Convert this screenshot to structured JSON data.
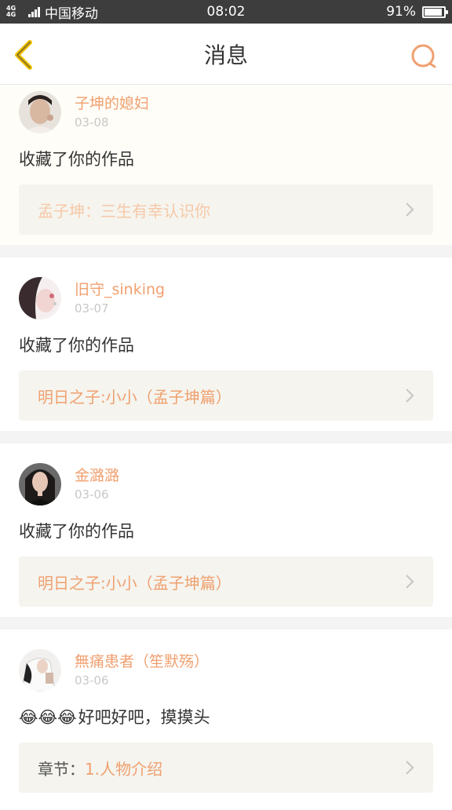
{
  "status_bar": {
    "network": "4G 4G",
    "carrier": "中国移动",
    "time": "08:02",
    "battery": "91%",
    "battery_level": 0.91
  },
  "header": {
    "title": "消息"
  },
  "colors": {
    "accent": "#f0a070",
    "back_icon": "#f2c200"
  },
  "messages": [
    {
      "user": "子坤的媳妇",
      "date": "03-08",
      "text": "收藏了你的作品",
      "work_title": "孟子坤：三生有幸认识你"
    },
    {
      "user": "旧守_sinking",
      "date": "03-07",
      "text": "收藏了你的作品",
      "work_title": "明日之子:小小（孟子坤篇）"
    },
    {
      "user": "金潞潞",
      "date": "03-06",
      "text": "收藏了你的作品",
      "work_title": "明日之子:小小（孟子坤篇）"
    },
    {
      "user": "無痛患者（笙默殇）",
      "date": "03-06",
      "text": "好吧好吧，摸摸头",
      "emoji": "😂😂😂",
      "work_label": "章节：",
      "work_title": "1.人物介绍"
    }
  ]
}
